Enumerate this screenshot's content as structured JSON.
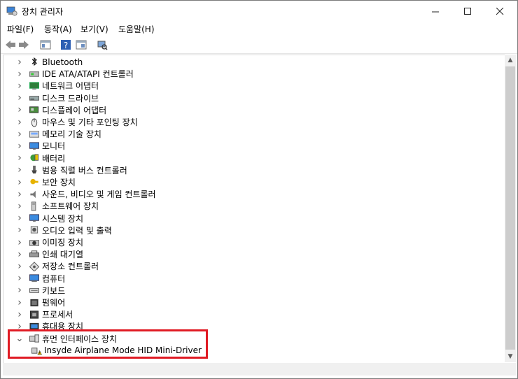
{
  "window": {
    "title": "장치 관리자"
  },
  "menu": [
    "파일(F)",
    "동작(A)",
    "보기(V)",
    "도움말(H)"
  ],
  "tree": [
    {
      "label": "Bluetooth",
      "icon": "bluetooth-icon",
      "expanded": false
    },
    {
      "label": "IDE ATA/ATAPI 컨트롤러",
      "icon": "ide-controller-icon",
      "expanded": false
    },
    {
      "label": "네트워크 어댑터",
      "icon": "network-adapter-icon",
      "expanded": false
    },
    {
      "label": "디스크 드라이브",
      "icon": "disk-drive-icon",
      "expanded": false
    },
    {
      "label": "디스플레이 어댑터",
      "icon": "display-adapter-icon",
      "expanded": false
    },
    {
      "label": "마우스 및 기타 포인팅 장치",
      "icon": "mouse-icon",
      "expanded": false
    },
    {
      "label": "메모리 기술 장치",
      "icon": "memory-device-icon",
      "expanded": false
    },
    {
      "label": "모니터",
      "icon": "monitor-icon",
      "expanded": false
    },
    {
      "label": "배터리",
      "icon": "battery-icon",
      "expanded": false
    },
    {
      "label": "범용 직렬 버스 컨트롤러",
      "icon": "usb-icon",
      "expanded": false
    },
    {
      "label": "보안 장치",
      "icon": "security-key-icon",
      "expanded": false
    },
    {
      "label": "사운드, 비디오 및 게임 컨트롤러",
      "icon": "speaker-icon",
      "expanded": false
    },
    {
      "label": "소프트웨어 장치",
      "icon": "software-device-icon",
      "expanded": false
    },
    {
      "label": "시스템 장치",
      "icon": "system-device-icon",
      "expanded": false
    },
    {
      "label": "오디오 입력 및 출력",
      "icon": "audio-io-icon",
      "expanded": false
    },
    {
      "label": "이미징 장치",
      "icon": "camera-icon",
      "expanded": false
    },
    {
      "label": "인쇄 대기열",
      "icon": "printer-icon",
      "expanded": false
    },
    {
      "label": "저장소 컨트롤러",
      "icon": "storage-controller-icon",
      "expanded": false
    },
    {
      "label": "컴퓨터",
      "icon": "computer-icon",
      "expanded": false
    },
    {
      "label": "키보드",
      "icon": "keyboard-icon",
      "expanded": false
    },
    {
      "label": "펌웨어",
      "icon": "firmware-icon",
      "expanded": false
    },
    {
      "label": "프로세서",
      "icon": "processor-icon",
      "expanded": false
    },
    {
      "label": "휴대용 장치",
      "icon": "portable-device-icon",
      "expanded": false
    },
    {
      "label": "휴먼 인터페이스 장치",
      "icon": "hid-icon",
      "expanded": true
    },
    {
      "label": "Insyde Airplane Mode HID Mini-Driver",
      "icon": "hid-warning-icon",
      "child": true
    }
  ],
  "colors": {
    "highlight": "#e01b24",
    "warning": "#f2c200"
  }
}
